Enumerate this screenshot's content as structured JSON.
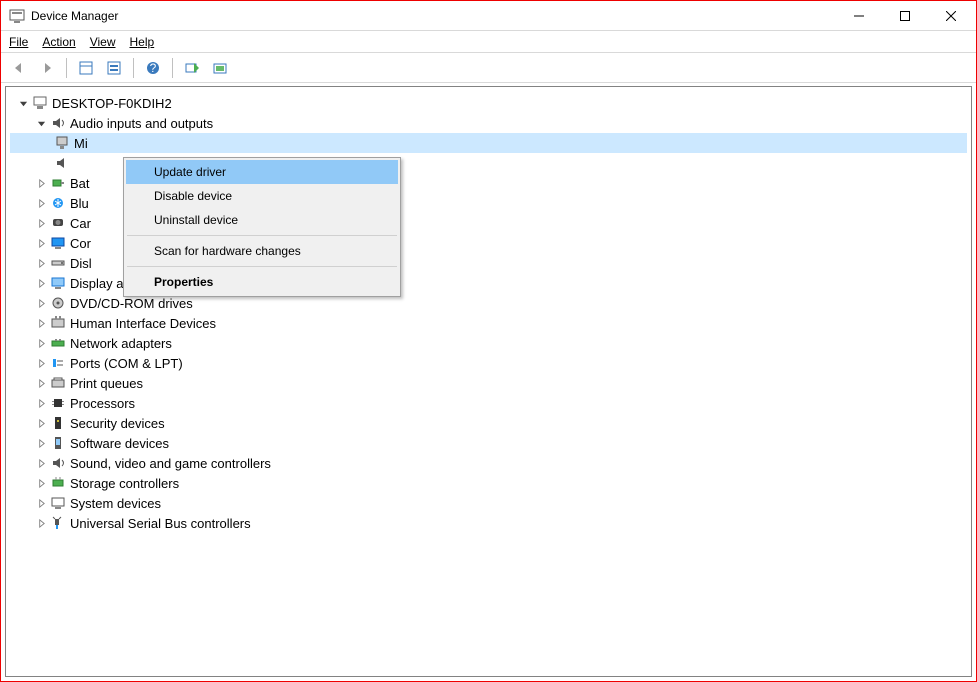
{
  "titlebar": {
    "title": "Device Manager"
  },
  "menubar": {
    "file": "File",
    "action": "Action",
    "view": "View",
    "help": "Help"
  },
  "tree": {
    "root": "DESKTOP-F0KDIH2",
    "audio_category": "Audio inputs and outputs",
    "audio_child1_prefix": "Mi",
    "audio_child2_hidden": "",
    "items": [
      "Bat",
      "Blu",
      "Car",
      "Cor",
      "Disl",
      "Display adapters",
      "DVD/CD-ROM drives",
      "Human Interface Devices",
      "Network adapters",
      "Ports (COM & LPT)",
      "Print queues",
      "Processors",
      "Security devices",
      "Software devices",
      "Sound, video and game controllers",
      "Storage controllers",
      "System devices",
      "Universal Serial Bus controllers"
    ]
  },
  "contextmenu": {
    "update": "Update driver",
    "disable": "Disable device",
    "uninstall": "Uninstall device",
    "scan": "Scan for hardware changes",
    "properties": "Properties"
  }
}
